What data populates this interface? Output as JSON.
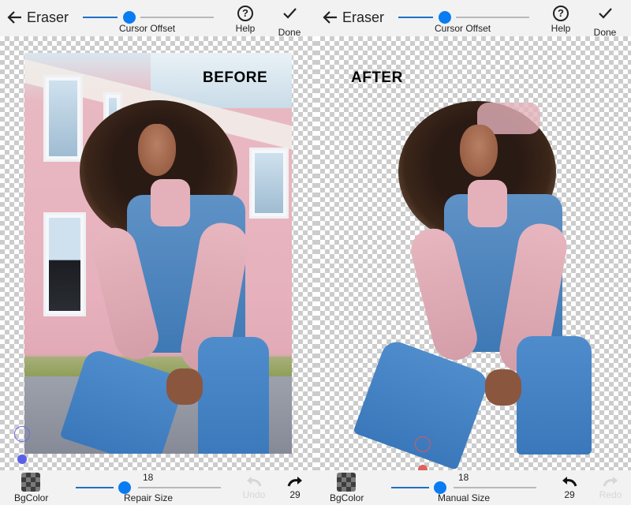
{
  "panels": [
    {
      "id": "before",
      "topbar": {
        "back_icon": "arrow-left-icon",
        "title": "Eraser",
        "slider_label": "Cursor Offset",
        "slider_value_fraction": 0.35,
        "help_label": "Help",
        "help_icon": "question-circle-icon",
        "done_label": "Done",
        "done_icon": "checkmark-icon"
      },
      "canvas": {
        "overlay_label": "BEFORE",
        "cursor_color": "#5b5fe8"
      },
      "bottombar": {
        "bgcolor_label": "BgColor",
        "size_value": "18",
        "size_label": "Repair Size",
        "undo_label": "Undo",
        "undo_enabled": false,
        "redo_label": "29",
        "redo_enabled": true
      }
    },
    {
      "id": "after",
      "topbar": {
        "back_icon": "arrow-left-icon",
        "title": "Eraser",
        "slider_label": "Cursor Offset",
        "slider_value_fraction": 0.35,
        "help_label": "Help",
        "help_icon": "question-circle-icon",
        "done_label": "Done",
        "done_icon": "checkmark-icon"
      },
      "canvas": {
        "overlay_label": "AFTER",
        "cursor_color": "#e05a5a"
      },
      "bottombar": {
        "bgcolor_label": "BgColor",
        "size_value": "18",
        "size_label": "Manual Size",
        "undo_label": "29",
        "undo_enabled": true,
        "redo_label": "Redo",
        "redo_enabled": false
      }
    }
  ],
  "colors": {
    "accent": "#0a7cf2",
    "bar_bg": "#f2f2f2",
    "disabled_text": "#d6d6d6"
  }
}
